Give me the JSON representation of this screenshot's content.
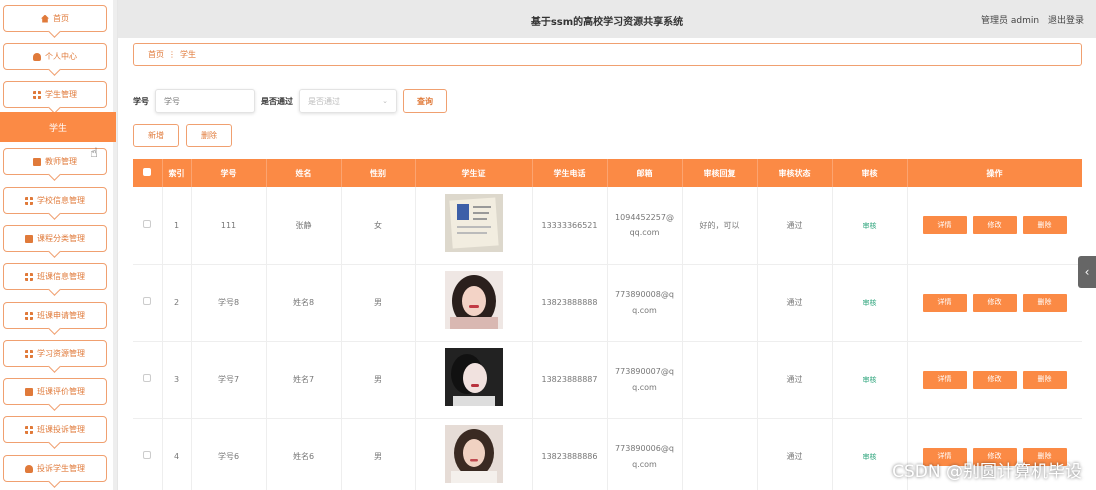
{
  "header": {
    "title": "基于ssm的高校学习资源共享系统",
    "user_label": "管理员 admin",
    "logout": "退出登录"
  },
  "sidebar": {
    "items": [
      {
        "label": "首页",
        "icon": "home-icon"
      },
      {
        "label": "个人中心",
        "icon": "person-icon"
      },
      {
        "label": "学生管理",
        "icon": "grid-icon"
      },
      {
        "label": "学生",
        "icon": ""
      },
      {
        "label": "教师管理",
        "icon": "clipboard-icon"
      },
      {
        "label": "学校信息管理",
        "icon": "grid-icon"
      },
      {
        "label": "课程分类管理",
        "icon": "list-icon"
      },
      {
        "label": "班课信息管理",
        "icon": "grid-icon"
      },
      {
        "label": "班课申请管理",
        "icon": "grid-icon"
      },
      {
        "label": "学习资源管理",
        "icon": "grid-icon"
      },
      {
        "label": "班课评价管理",
        "icon": "thumb-icon"
      },
      {
        "label": "班课投诉管理",
        "icon": "grid-icon"
      },
      {
        "label": "投诉学生管理",
        "icon": "person-icon"
      }
    ]
  },
  "breadcrumb": {
    "home": "首页",
    "sep": "⋮",
    "current": "学生"
  },
  "search": {
    "id_label": "学号",
    "id_placeholder": "学号",
    "pass_label": "是否通过",
    "pass_placeholder": "是否通过",
    "query_button": "查询"
  },
  "actions": {
    "add": "新增",
    "delete": "删除"
  },
  "table": {
    "headers": [
      "索引",
      "学号",
      "姓名",
      "性别",
      "学生证",
      "学生电话",
      "邮箱",
      "审核回复",
      "审核状态",
      "审核",
      "操作"
    ],
    "rows": [
      {
        "index": "1",
        "id": "111",
        "name": "张静",
        "gender": "女",
        "photo": "id-card-photo",
        "phone": "13333366521",
        "email": "1094452257@qq.com",
        "reply": "好的，可以",
        "status": "通过",
        "review": "审核"
      },
      {
        "index": "2",
        "id": "学号8",
        "name": "姓名8",
        "gender": "男",
        "photo": "portrait-photo",
        "phone": "13823888888",
        "email": "773890008@qq.com",
        "reply": "",
        "status": "通过",
        "review": "审核"
      },
      {
        "index": "3",
        "id": "学号7",
        "name": "姓名7",
        "gender": "男",
        "photo": "portrait-photo",
        "phone": "13823888887",
        "email": "773890007@qq.com",
        "reply": "",
        "status": "通过",
        "review": "审核"
      },
      {
        "index": "4",
        "id": "学号6",
        "name": "姓名6",
        "gender": "男",
        "photo": "portrait-photo",
        "phone": "13823888886",
        "email": "773890006@qq.com",
        "reply": "",
        "status": "通过",
        "review": "审核"
      }
    ],
    "op_labels": {
      "detail": "详情",
      "edit": "修改",
      "delete": "删除"
    }
  },
  "watermark": "CSDN @别圆计算机毕设",
  "colors": {
    "accent": "#fb8a45",
    "approve": "#2aa37a"
  }
}
